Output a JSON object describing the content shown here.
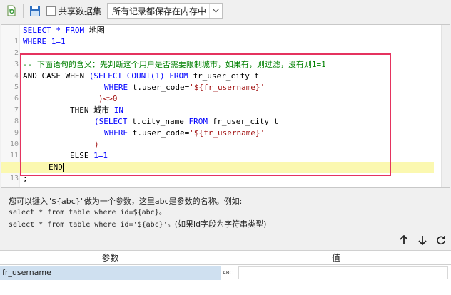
{
  "toolbar": {
    "refresh_icon": "refresh-doc-icon",
    "save_icon": "save-icon",
    "share_label": "共享数据集",
    "share_checked": false,
    "cache_mode": "所有记录都保存在内存中"
  },
  "editor": {
    "highlight_color": "#fbf8b0",
    "box_color": "#e5335f",
    "line_numbers": [
      "1",
      "2",
      "3",
      "4",
      "5",
      "6",
      "7",
      "8",
      "9",
      "10",
      "11",
      "12",
      "13"
    ],
    "l1_kw": "SELECT * FROM",
    "l1_t": " 地图",
    "l2_kw": "WHERE",
    "l2_num": " 1=1",
    "l4_cm": "-- 下面语句的含义：先判断这个用户是否需要限制城市，如果有，则过滤，没有则1=1",
    "l5_a": "AND CASE WHEN ",
    "l5_b": "(SELECT COUNT(1) FROM",
    "l5_c": " fr_user_city t",
    "l6_kw": "WHERE",
    "l6_t": " t.user_code=",
    "l6_s": "'${fr_username}'",
    "l7": ")<>0",
    "l8_a": "THEN 城市 ",
    "l8_kw": "IN",
    "l9_kw": "(SELECT",
    "l9_t": " t.city_name ",
    "l9_kw2": "FROM",
    "l9_t2": " fr_user_city t",
    "l10_kw": "WHERE",
    "l10_t": " t.user_code=",
    "l10_s": "'${fr_username}'",
    "l11": ")",
    "l12_a": "ELSE ",
    "l12_n": "1=1",
    "l13": "END",
    "l14": ";"
  },
  "help": {
    "line1": "您可以键入\"${abc}\"做为一个参数，这里abc是参数的名称。例如:",
    "line2": "select * from table where id=${abc}。",
    "line3a": "select * from table where id='${abc}'。",
    "line3b": "(如果id字段为字符串类型)"
  },
  "controls": {
    "up_icon": "arrow-up-icon",
    "down_icon": "arrow-down-icon",
    "refresh_icon": "refresh-icon"
  },
  "params": {
    "col_name": "参数",
    "col_value": "值",
    "rows": [
      {
        "name": "fr_username",
        "type_icon": "abc-text-icon",
        "type_label": "ABC",
        "value": ""
      }
    ]
  }
}
